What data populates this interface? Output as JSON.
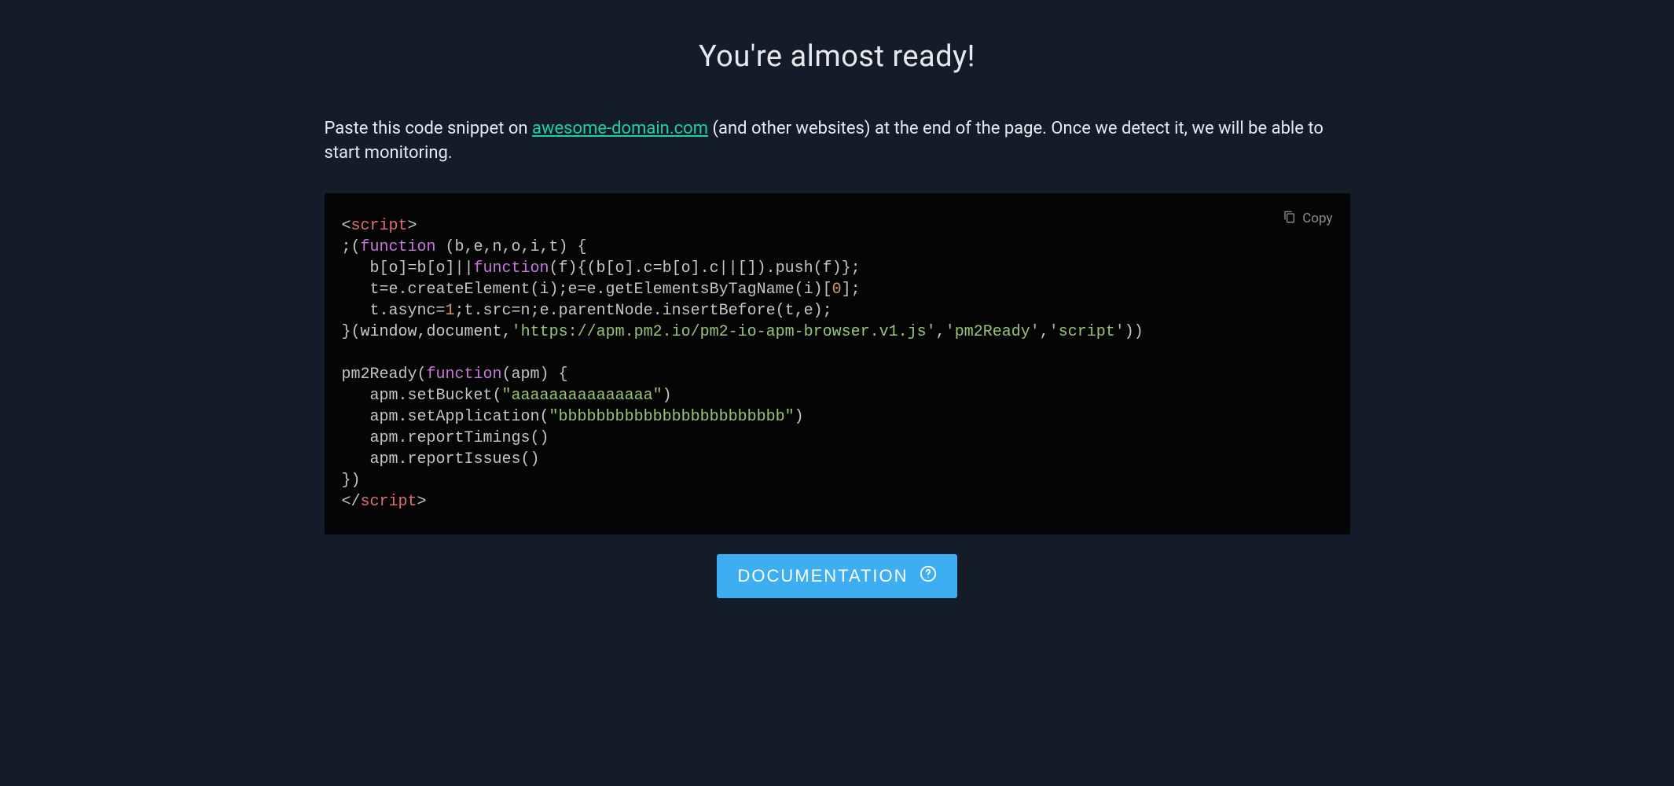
{
  "title": "You're almost ready!",
  "subtitle": {
    "before": "Paste this code snippet on ",
    "link_text": "awesome-domain.com",
    "after": " (and other websites) at the end of the page. Once we detect it, we will be able to start monitoring."
  },
  "copy_label": "Copy",
  "documentation_label": "DOCUMENTATION",
  "code": {
    "tag_open": "script",
    "kw_function": "function",
    "iife_params": " (b,e,n,o,i,t) {",
    "line2": "   b[o]=b[o]||",
    "line2_fn": "function",
    "line2_rest": "(f){(b[o].c=b[o].c||[]).push(f)};",
    "line3a": "   t=e.createElement(i);e=e.getElementsByTagName(i)[",
    "line3_num": "0",
    "line3b": "];",
    "line4a": "   t.async=",
    "line4_num": "1",
    "line4b": ";t.src=n;e.parentNode.insertBefore(t,e);",
    "close_brace": "}(",
    "window": "window",
    "document": "document",
    "url": "'https://apm.pm2.io/pm2-io-apm-browser.v1.js'",
    "pm2ready_str": "'pm2Ready'",
    "script_str": "'script'",
    "close_iife": "))",
    "pm2_call": "pm2Ready(",
    "fn2": "function",
    "fn2_params": "(apm) {",
    "setBucket_a": "   apm.setBucket(",
    "setBucket_str": "\"aaaaaaaaaaaaaaa\"",
    "setBucket_b": ")",
    "setApp_a": "   apm.setApplication(",
    "setApp_str": "\"bbbbbbbbbbbbbbbbbbbbbbbb\"",
    "setApp_b": ")",
    "reportTimings": "   apm.reportTimings()",
    "reportIssues": "   apm.reportIssues()",
    "close_fn": "})",
    "tag_close": "script"
  }
}
